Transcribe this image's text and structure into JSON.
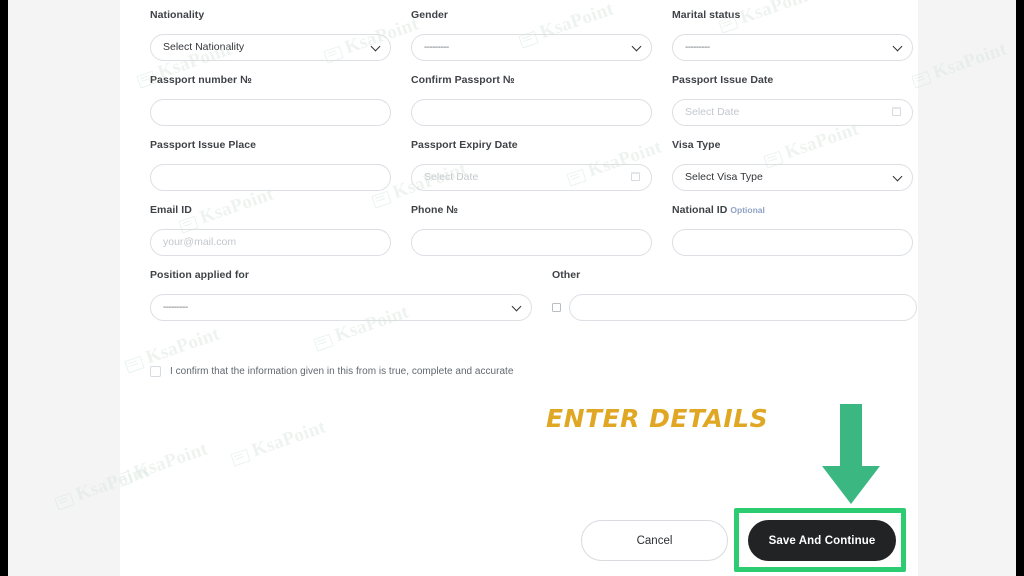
{
  "theme": {
    "card_bg": "#ffffff",
    "page_bg": "#f4f4f5",
    "label_color": "#3f4246",
    "placeholder_color": "#c3c7cc",
    "accent_dark": "#222325",
    "annotation_gold": "#e0a724",
    "annotation_green": "#2ecc71",
    "optional_color": "#8fa3c4"
  },
  "watermark": {
    "text": "KsaPoint",
    "icon": "document-stack-icon"
  },
  "form": {
    "rows": [
      {
        "fields": [
          {
            "key": "nationality",
            "label": "Nationality",
            "type": "select",
            "value": "Select Nationality",
            "icon": "chevron-down-icon"
          },
          {
            "key": "gender",
            "label": "Gender",
            "type": "select",
            "value": "---------",
            "icon": "chevron-down-icon"
          },
          {
            "key": "marital_status",
            "label": "Marital status",
            "type": "select",
            "value": "---------",
            "icon": "chevron-down-icon"
          }
        ]
      },
      {
        "fields": [
          {
            "key": "passport_number",
            "label": "Passport number №",
            "type": "text",
            "value": "",
            "placeholder": ""
          },
          {
            "key": "confirm_passport",
            "label": "Confirm Passport №",
            "type": "text",
            "value": "",
            "placeholder": ""
          },
          {
            "key": "passport_issue_date",
            "label": "Passport Issue Date",
            "type": "date",
            "value": "",
            "placeholder": "Select Date",
            "icon": "calendar-icon"
          }
        ]
      },
      {
        "fields": [
          {
            "key": "passport_issue_place",
            "label": "Passport Issue Place",
            "type": "text",
            "value": "",
            "placeholder": ""
          },
          {
            "key": "passport_expiry_date",
            "label": "Passport Expiry Date",
            "type": "date",
            "value": "",
            "placeholder": "Select Date",
            "icon": "calendar-icon"
          },
          {
            "key": "visa_type",
            "label": "Visa Type",
            "type": "select",
            "value": "Select Visa Type",
            "icon": "chevron-down-icon"
          }
        ]
      },
      {
        "fields": [
          {
            "key": "email_id",
            "label": "Email ID",
            "type": "email",
            "value": "",
            "placeholder": "your@mail.com"
          },
          {
            "key": "phone_number",
            "label": "Phone №",
            "type": "tel",
            "value": "",
            "placeholder": ""
          },
          {
            "key": "national_id",
            "label": "National ID",
            "label_suffix": "Optional",
            "type": "text",
            "value": "",
            "placeholder": ""
          }
        ]
      }
    ],
    "position_row": {
      "position_label": "Position applied for",
      "position_value": "---------",
      "position_icon": "chevron-down-icon",
      "other_label": "Other",
      "other_checkbox_checked": false,
      "other_value": "",
      "other_placeholder": ""
    },
    "confirm": {
      "checked": false,
      "text": "I confirm that the information given in this from is true, complete and accurate"
    }
  },
  "footer": {
    "cancel_label": "Cancel",
    "save_label": "Save And Continue"
  },
  "annotation": {
    "callout_text": "ENTER DETAILS",
    "arrow_icon": "arrow-down-icon",
    "highlight_target": "save-and-continue-button"
  }
}
